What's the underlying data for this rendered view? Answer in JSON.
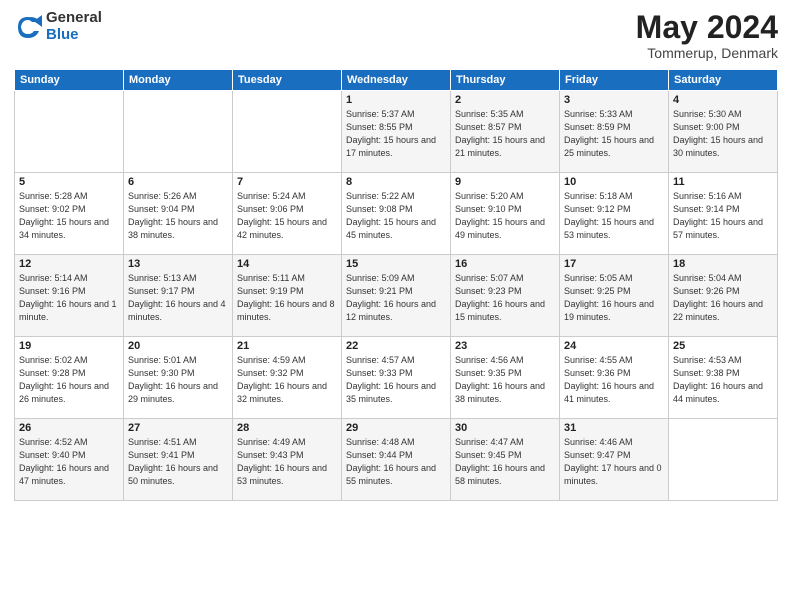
{
  "logo": {
    "general": "General",
    "blue": "Blue"
  },
  "title": "May 2024",
  "location": "Tommerup, Denmark",
  "days_header": [
    "Sunday",
    "Monday",
    "Tuesday",
    "Wednesday",
    "Thursday",
    "Friday",
    "Saturday"
  ],
  "weeks": [
    [
      {
        "day": "",
        "info": ""
      },
      {
        "day": "",
        "info": ""
      },
      {
        "day": "",
        "info": ""
      },
      {
        "day": "1",
        "info": "Sunrise: 5:37 AM\nSunset: 8:55 PM\nDaylight: 15 hours\nand 17 minutes."
      },
      {
        "day": "2",
        "info": "Sunrise: 5:35 AM\nSunset: 8:57 PM\nDaylight: 15 hours\nand 21 minutes."
      },
      {
        "day": "3",
        "info": "Sunrise: 5:33 AM\nSunset: 8:59 PM\nDaylight: 15 hours\nand 25 minutes."
      },
      {
        "day": "4",
        "info": "Sunrise: 5:30 AM\nSunset: 9:00 PM\nDaylight: 15 hours\nand 30 minutes."
      }
    ],
    [
      {
        "day": "5",
        "info": "Sunrise: 5:28 AM\nSunset: 9:02 PM\nDaylight: 15 hours\nand 34 minutes."
      },
      {
        "day": "6",
        "info": "Sunrise: 5:26 AM\nSunset: 9:04 PM\nDaylight: 15 hours\nand 38 minutes."
      },
      {
        "day": "7",
        "info": "Sunrise: 5:24 AM\nSunset: 9:06 PM\nDaylight: 15 hours\nand 42 minutes."
      },
      {
        "day": "8",
        "info": "Sunrise: 5:22 AM\nSunset: 9:08 PM\nDaylight: 15 hours\nand 45 minutes."
      },
      {
        "day": "9",
        "info": "Sunrise: 5:20 AM\nSunset: 9:10 PM\nDaylight: 15 hours\nand 49 minutes."
      },
      {
        "day": "10",
        "info": "Sunrise: 5:18 AM\nSunset: 9:12 PM\nDaylight: 15 hours\nand 53 minutes."
      },
      {
        "day": "11",
        "info": "Sunrise: 5:16 AM\nSunset: 9:14 PM\nDaylight: 15 hours\nand 57 minutes."
      }
    ],
    [
      {
        "day": "12",
        "info": "Sunrise: 5:14 AM\nSunset: 9:16 PM\nDaylight: 16 hours\nand 1 minute."
      },
      {
        "day": "13",
        "info": "Sunrise: 5:13 AM\nSunset: 9:17 PM\nDaylight: 16 hours\nand 4 minutes."
      },
      {
        "day": "14",
        "info": "Sunrise: 5:11 AM\nSunset: 9:19 PM\nDaylight: 16 hours\nand 8 minutes."
      },
      {
        "day": "15",
        "info": "Sunrise: 5:09 AM\nSunset: 9:21 PM\nDaylight: 16 hours\nand 12 minutes."
      },
      {
        "day": "16",
        "info": "Sunrise: 5:07 AM\nSunset: 9:23 PM\nDaylight: 16 hours\nand 15 minutes."
      },
      {
        "day": "17",
        "info": "Sunrise: 5:05 AM\nSunset: 9:25 PM\nDaylight: 16 hours\nand 19 minutes."
      },
      {
        "day": "18",
        "info": "Sunrise: 5:04 AM\nSunset: 9:26 PM\nDaylight: 16 hours\nand 22 minutes."
      }
    ],
    [
      {
        "day": "19",
        "info": "Sunrise: 5:02 AM\nSunset: 9:28 PM\nDaylight: 16 hours\nand 26 minutes."
      },
      {
        "day": "20",
        "info": "Sunrise: 5:01 AM\nSunset: 9:30 PM\nDaylight: 16 hours\nand 29 minutes."
      },
      {
        "day": "21",
        "info": "Sunrise: 4:59 AM\nSunset: 9:32 PM\nDaylight: 16 hours\nand 32 minutes."
      },
      {
        "day": "22",
        "info": "Sunrise: 4:57 AM\nSunset: 9:33 PM\nDaylight: 16 hours\nand 35 minutes."
      },
      {
        "day": "23",
        "info": "Sunrise: 4:56 AM\nSunset: 9:35 PM\nDaylight: 16 hours\nand 38 minutes."
      },
      {
        "day": "24",
        "info": "Sunrise: 4:55 AM\nSunset: 9:36 PM\nDaylight: 16 hours\nand 41 minutes."
      },
      {
        "day": "25",
        "info": "Sunrise: 4:53 AM\nSunset: 9:38 PM\nDaylight: 16 hours\nand 44 minutes."
      }
    ],
    [
      {
        "day": "26",
        "info": "Sunrise: 4:52 AM\nSunset: 9:40 PM\nDaylight: 16 hours\nand 47 minutes."
      },
      {
        "day": "27",
        "info": "Sunrise: 4:51 AM\nSunset: 9:41 PM\nDaylight: 16 hours\nand 50 minutes."
      },
      {
        "day": "28",
        "info": "Sunrise: 4:49 AM\nSunset: 9:43 PM\nDaylight: 16 hours\nand 53 minutes."
      },
      {
        "day": "29",
        "info": "Sunrise: 4:48 AM\nSunset: 9:44 PM\nDaylight: 16 hours\nand 55 minutes."
      },
      {
        "day": "30",
        "info": "Sunrise: 4:47 AM\nSunset: 9:45 PM\nDaylight: 16 hours\nand 58 minutes."
      },
      {
        "day": "31",
        "info": "Sunrise: 4:46 AM\nSunset: 9:47 PM\nDaylight: 17 hours\nand 0 minutes."
      },
      {
        "day": "",
        "info": ""
      }
    ]
  ]
}
